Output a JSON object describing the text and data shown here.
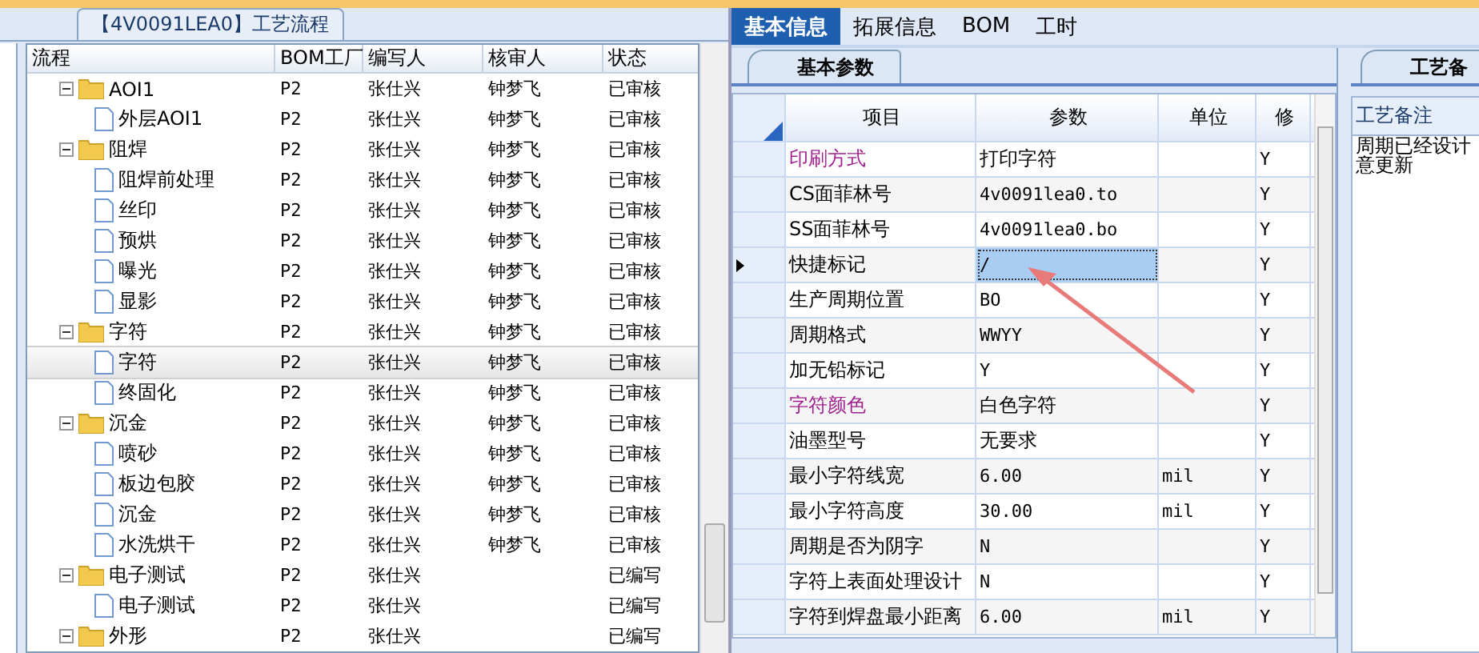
{
  "flow_panel": {
    "title": "【4V0091LEA0】工艺流程",
    "columns": [
      "流程",
      "BOM工厂",
      "编写人",
      "核审人",
      "状态"
    ],
    "tree": [
      {
        "name": "AOI1",
        "kind": "folder",
        "expanded": true,
        "selected": false,
        "bom": "P2",
        "writer": "张仕兴",
        "reviewer": "钟梦飞",
        "status": "已审核",
        "children": [
          {
            "name": "外层AOI1",
            "kind": "file",
            "selected": false,
            "bom": "P2",
            "writer": "张仕兴",
            "reviewer": "钟梦飞",
            "status": "已审核"
          }
        ]
      },
      {
        "name": "阻焊",
        "kind": "folder",
        "expanded": true,
        "selected": false,
        "bom": "P2",
        "writer": "张仕兴",
        "reviewer": "钟梦飞",
        "status": "已审核",
        "children": [
          {
            "name": "阻焊前处理",
            "kind": "file",
            "selected": false,
            "bom": "P2",
            "writer": "张仕兴",
            "reviewer": "钟梦飞",
            "status": "已审核"
          },
          {
            "name": "丝印",
            "kind": "file",
            "selected": false,
            "bom": "P2",
            "writer": "张仕兴",
            "reviewer": "钟梦飞",
            "status": "已审核"
          },
          {
            "name": "预烘",
            "kind": "file",
            "selected": false,
            "bom": "P2",
            "writer": "张仕兴",
            "reviewer": "钟梦飞",
            "status": "已审核"
          },
          {
            "name": "曝光",
            "kind": "file",
            "selected": false,
            "bom": "P2",
            "writer": "张仕兴",
            "reviewer": "钟梦飞",
            "status": "已审核"
          },
          {
            "name": "显影",
            "kind": "file",
            "selected": false,
            "bom": "P2",
            "writer": "张仕兴",
            "reviewer": "钟梦飞",
            "status": "已审核"
          }
        ]
      },
      {
        "name": "字符",
        "kind": "folder",
        "expanded": true,
        "selected": false,
        "bom": "P2",
        "writer": "张仕兴",
        "reviewer": "钟梦飞",
        "status": "已审核",
        "children": [
          {
            "name": "字符",
            "kind": "file",
            "selected": true,
            "bom": "P2",
            "writer": "张仕兴",
            "reviewer": "钟梦飞",
            "status": "已审核"
          },
          {
            "name": "终固化",
            "kind": "file",
            "selected": false,
            "bom": "P2",
            "writer": "张仕兴",
            "reviewer": "钟梦飞",
            "status": "已审核"
          }
        ]
      },
      {
        "name": "沉金",
        "kind": "folder",
        "expanded": true,
        "selected": false,
        "bom": "P2",
        "writer": "张仕兴",
        "reviewer": "钟梦飞",
        "status": "已审核",
        "children": [
          {
            "name": "喷砂",
            "kind": "file",
            "selected": false,
            "bom": "P2",
            "writer": "张仕兴",
            "reviewer": "钟梦飞",
            "status": "已审核"
          },
          {
            "name": "板边包胶",
            "kind": "file",
            "selected": false,
            "bom": "P2",
            "writer": "张仕兴",
            "reviewer": "钟梦飞",
            "status": "已审核"
          },
          {
            "name": "沉金",
            "kind": "file",
            "selected": false,
            "bom": "P2",
            "writer": "张仕兴",
            "reviewer": "钟梦飞",
            "status": "已审核"
          },
          {
            "name": "水洗烘干",
            "kind": "file",
            "selected": false,
            "bom": "P2",
            "writer": "张仕兴",
            "reviewer": "钟梦飞",
            "status": "已审核"
          }
        ]
      },
      {
        "name": "电子测试",
        "kind": "folder",
        "expanded": true,
        "selected": false,
        "bom": "P2",
        "writer": "张仕兴",
        "status": "已编写",
        "children": [
          {
            "name": "电子测试",
            "kind": "file",
            "selected": false,
            "bom": "P2",
            "writer": "张仕兴",
            "status": "已编写"
          }
        ]
      },
      {
        "name": "外形",
        "kind": "folder",
        "expanded": true,
        "selected": false,
        "bom": "P2",
        "writer": "张仕兴",
        "status": "已编写"
      }
    ]
  },
  "tabs": [
    {
      "label": "基本信息",
      "selected": true
    },
    {
      "label": "拓展信息",
      "selected": false
    },
    {
      "label": "BOM",
      "selected": false
    },
    {
      "label": "工时",
      "selected": false
    }
  ],
  "params_panel": {
    "title": "基本参数",
    "columns": [
      "项目",
      "参数",
      "单位",
      "修"
    ],
    "rows": [
      {
        "item": "印刷方式",
        "color": "#a0208f",
        "value": "打印字符",
        "modify": "Y",
        "selected": false
      },
      {
        "item": "CS面菲林号",
        "color": "#000000",
        "value": "4v0091lea0.to",
        "modify": "Y",
        "selected": false
      },
      {
        "item": "SS面菲林号",
        "color": "#000000",
        "value": "4v0091lea0.bo",
        "modify": "Y",
        "selected": false
      },
      {
        "item": "快捷标记",
        "color": "#000000",
        "value": "/",
        "modify": "Y",
        "selected": true
      },
      {
        "item": "生产周期位置",
        "color": "#000000",
        "value": "BO",
        "modify": "Y",
        "selected": false
      },
      {
        "item": "周期格式",
        "color": "#000000",
        "value": "WWYY",
        "modify": "Y",
        "selected": false
      },
      {
        "item": "加无铅标记",
        "color": "#000000",
        "value": "Y",
        "modify": "Y",
        "selected": false
      },
      {
        "item": "字符颜色",
        "color": "#a0208f",
        "value": "白色字符",
        "modify": "Y",
        "selected": false
      },
      {
        "item": "油墨型号",
        "color": "#000000",
        "value": "无要求",
        "modify": "Y",
        "selected": false
      },
      {
        "item": "最小字符线宽",
        "color": "#000000",
        "value": "6.00",
        "unit": "mil",
        "modify": "Y",
        "selected": false
      },
      {
        "item": "最小字符高度",
        "color": "#000000",
        "value": "30.00",
        "unit": "mil",
        "modify": "Y",
        "selected": false
      },
      {
        "item": "周期是否为阴字",
        "color": "#000000",
        "value": "N",
        "modify": "Y",
        "selected": false
      },
      {
        "item": "字符上表面处理设计",
        "color": "#000000",
        "value": "N",
        "modify": "Y",
        "selected": false
      },
      {
        "item": "字符到焊盘最小距离",
        "color": "#000000",
        "value": "6.00",
        "unit": "mil",
        "modify": "Y",
        "selected": false
      }
    ]
  },
  "notes_panel": {
    "title": "工艺备",
    "label": "工艺备注",
    "lines": [
      "周期已经设计",
      "意更新"
    ]
  }
}
